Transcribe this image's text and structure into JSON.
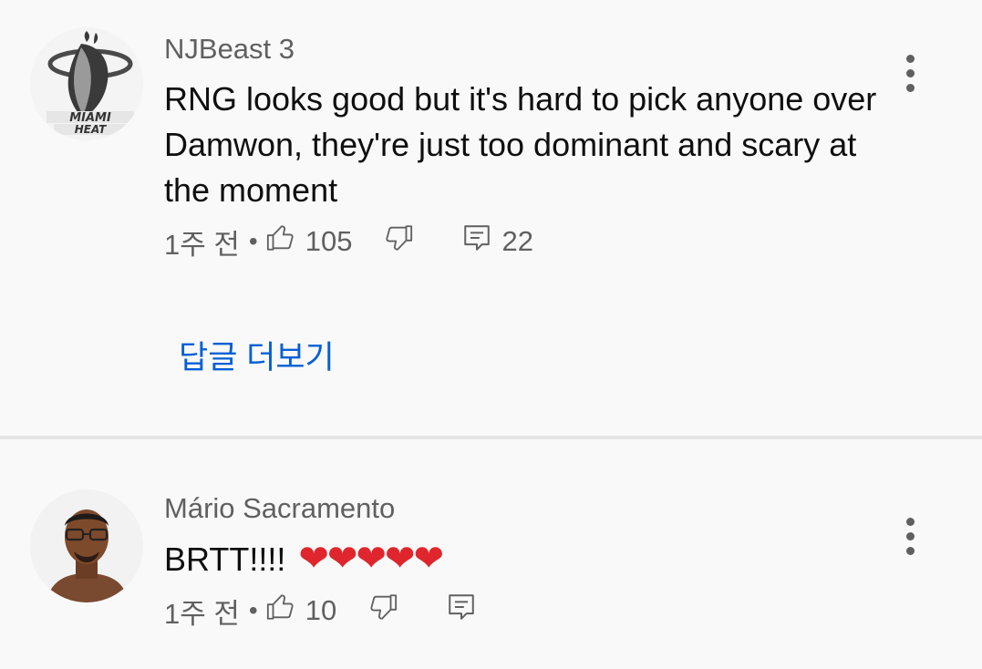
{
  "comments": [
    {
      "author": "NJBeast 3",
      "text": "RNG looks good but it's hard to pick anyone over Damwon, they're just too dominant and scary at the moment",
      "time": "1주 전",
      "separator": "•",
      "likes": "105",
      "replies": "22",
      "avatar_icon": "miami-heat-logo",
      "avatar_logo_text": "MIAMI HEAT",
      "more_replies_label": "답글 더보기"
    },
    {
      "author": "Mário Sacramento",
      "text": "BRTT!!!!",
      "hearts": "❤❤❤❤❤",
      "time": "1주 전",
      "separator": "•",
      "likes": "10",
      "replies": "",
      "avatar_icon": "user-photo"
    }
  ],
  "colors": {
    "background": "#f9f9f9",
    "link": "#065fd4",
    "secondary_text": "#606060",
    "heart": "#e0262d"
  },
  "icons": [
    "thumbs-up-icon",
    "thumbs-down-icon",
    "reply-icon",
    "more-vert-icon"
  ]
}
